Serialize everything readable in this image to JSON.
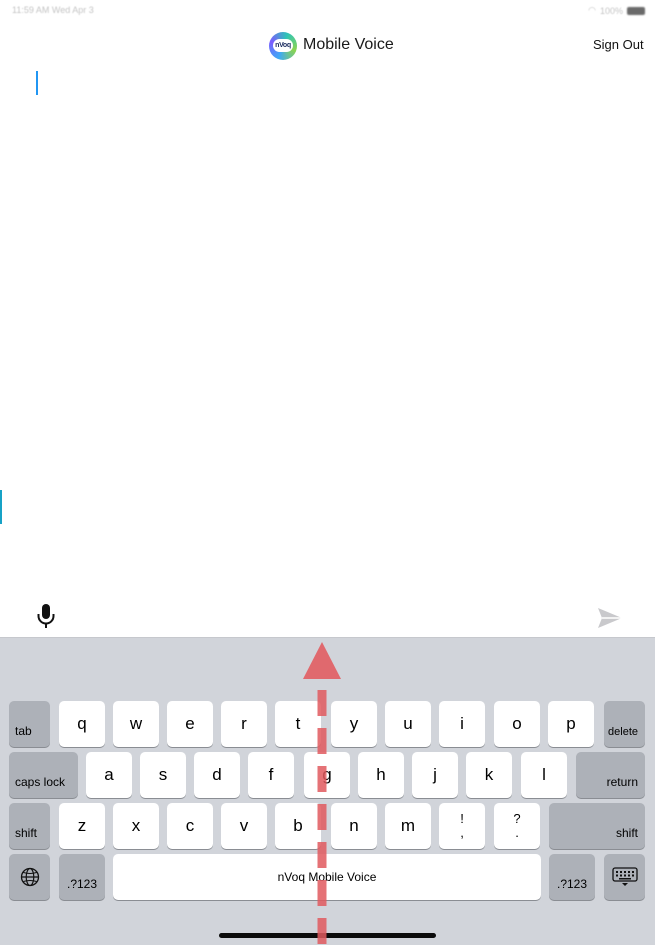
{
  "status_bar": {
    "time": "11:59 AM",
    "date": "Wed Apr 3",
    "center": "",
    "battery": "100%"
  },
  "header": {
    "title": "Mobile Voice",
    "logo_text": "nVoq",
    "sign_out": "Sign Out"
  },
  "editor": {
    "text": ""
  },
  "accessory": {
    "mic": "microphone-icon",
    "send": "send-icon"
  },
  "keyboard": {
    "row1": [
      "q",
      "w",
      "e",
      "r",
      "t",
      "y",
      "u",
      "i",
      "o",
      "p"
    ],
    "row2": [
      "a",
      "s",
      "d",
      "f",
      "g",
      "h",
      "j",
      "k",
      "l"
    ],
    "row3": [
      "z",
      "x",
      "c",
      "v",
      "b",
      "n",
      "m"
    ],
    "exclam_top": "!",
    "exclam_bottom": ",",
    "question_top": "?",
    "question_bottom": ".",
    "tab": "tab",
    "delete": "delete",
    "caps_lock": "caps lock",
    "return": "return",
    "shift": "shift",
    "numbers": ".?123",
    "space": "nVoq Mobile Voice"
  },
  "annotation": {
    "gesture": "swipe-up",
    "color": "#e15a5f"
  },
  "colors": {
    "keyboard_bg": "#d1d4da",
    "key": "#ffffff",
    "dark_key": "#adb1b8",
    "cursor": "#2196f3"
  }
}
